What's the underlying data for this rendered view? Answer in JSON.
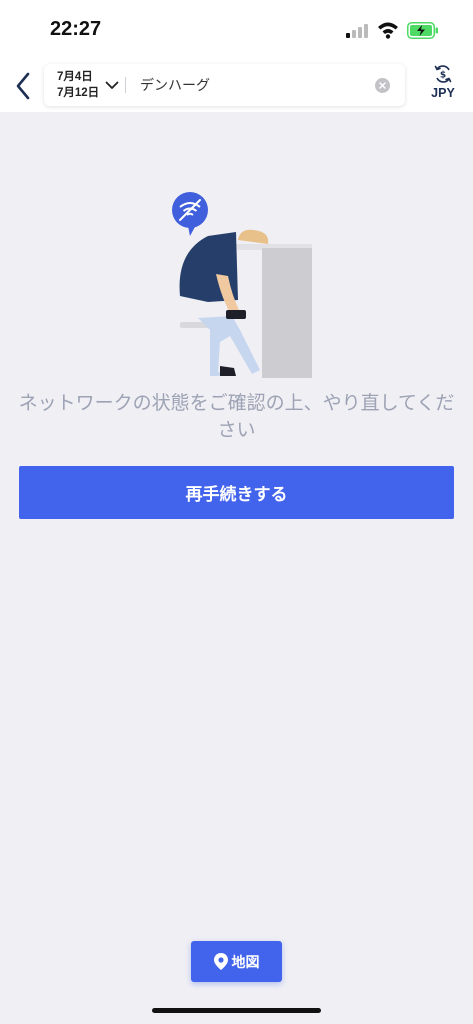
{
  "status_bar": {
    "time": "22:27",
    "icons": [
      "signal-icon",
      "wifi-icon",
      "battery-charging-icon"
    ],
    "battery_color": "#4cd964"
  },
  "header": {
    "check_in": "7月4日",
    "check_out": "7月12日",
    "destination": "デンハーグ",
    "currency": "JPY",
    "icons": [
      "back-chevron-icon",
      "chevron-down-icon",
      "clear-icon",
      "currency-exchange-icon"
    ]
  },
  "error": {
    "message": "ネットワークの状態をご確認の上、やり直してください",
    "illustration": "no-wifi-person-illustration"
  },
  "actions": {
    "retry_label": "再手続きする",
    "map_label": "地図",
    "map_icon": "location-pin-icon"
  },
  "colors": {
    "accent": "#4263eb",
    "background": "#efeff4",
    "message_text": "#9da3b4",
    "header_text": "#1d2f55"
  }
}
